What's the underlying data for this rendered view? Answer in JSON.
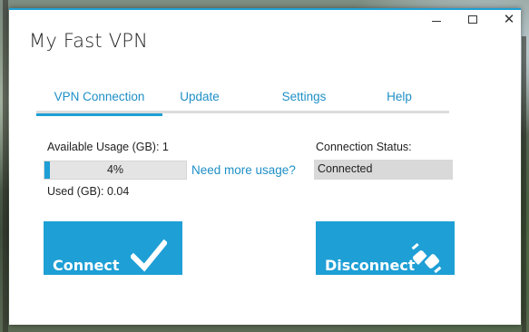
{
  "window": {
    "title": "My Fast VPN",
    "accent_color": "#1e9fd5",
    "controls": [
      "minimize-icon",
      "maximize-icon",
      "close-icon"
    ],
    "close_glyph": "✕"
  },
  "tabs": [
    {
      "label": "VPN Connection",
      "active": true
    },
    {
      "label": "Update",
      "active": false
    },
    {
      "label": "Settings",
      "active": false
    },
    {
      "label": "Help",
      "active": false
    }
  ],
  "usage": {
    "available_label": "Available Usage (GB): 1",
    "progress_text": "4%",
    "progress_fraction": 0.04,
    "used_label": "Used (GB): 0.04",
    "more_link": "Need more usage?"
  },
  "status": {
    "label": "Connection Status:",
    "value": "Connected"
  },
  "buttons": {
    "connect_label": "Connect",
    "connect_icon": "checkmark-icon",
    "disconnect_label": "Disconnect",
    "disconnect_icon": "unplug-icon"
  }
}
